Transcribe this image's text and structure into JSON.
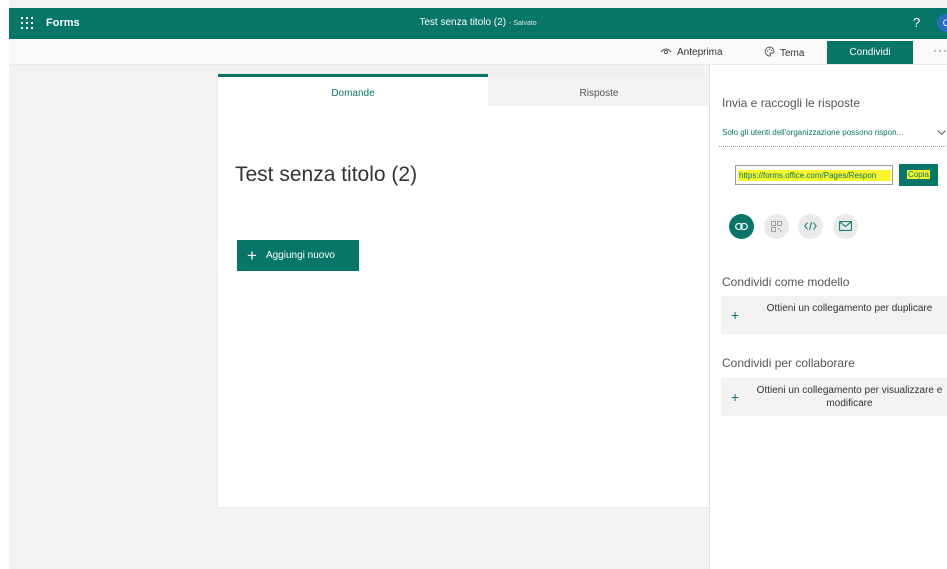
{
  "topbar": {
    "app_name": "Forms",
    "doc_title": "Test senza titolo (2)",
    "saved_status": "- Salvato",
    "help": "?",
    "avatar": "C"
  },
  "commands": {
    "preview": "Anteprima",
    "theme": "Tema",
    "share": "Condividi",
    "more": "···"
  },
  "card": {
    "tabs": [
      {
        "label": "Domande",
        "active": true
      },
      {
        "label": "Risposte",
        "active": false
      }
    ],
    "form_title": "Test senza titolo  (2)",
    "add_new": "Aggiungi nuovo"
  },
  "share_panel": {
    "heading": "Invia e raccogli le risposte",
    "audience": "Solo gli utenti dell'organizzazione possono rispon...",
    "link": "https://forms.office.com/Pages/Respon",
    "copy": "Copia",
    "share_methods": [
      "link-icon",
      "qr-code-icon",
      "embed-icon",
      "email-icon"
    ],
    "template_heading": "Condividi come modello",
    "template_option": "Ottieni un collegamento per duplicare",
    "collab_heading": "Condividi per collaborare",
    "collab_option": "Ottieni un collegamento per visualizzare e modificare"
  },
  "colors": {
    "accent": "#077568",
    "highlight": "#f7f52b",
    "background": "#f3f2f1"
  }
}
